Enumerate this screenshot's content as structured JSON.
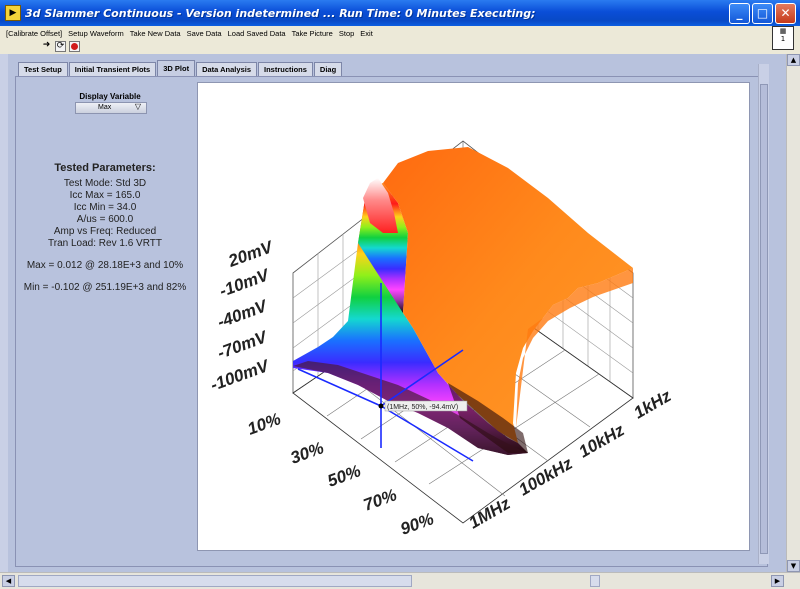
{
  "window": {
    "title": "3d Slammer Continuous - Version indetermined ...  Run Time: 0 Minutes  Executing;"
  },
  "menu": [
    "[Calibrate Offset]",
    "Setup Waveform",
    "Take New Data",
    "Save Data",
    "Load Saved Data",
    "Take Picture",
    "Stop",
    "Exit"
  ],
  "tabs": [
    "Test Setup",
    "Initial Transient Plots",
    "3D Plot",
    "Data Analysis",
    "Instructions",
    "Diag"
  ],
  "active_tab": "3D Plot",
  "display_variable": {
    "label": "Display Variable",
    "value": "Max"
  },
  "params": {
    "heading": "Tested Parameters:",
    "lines": [
      "Test Mode: Std 3D",
      "Icc Max = 165.0",
      "Icc Min = 34.0",
      "A/us = 600.0",
      "Amp vs Freq: Reduced",
      "Tran Load: Rev 1.6 VRTT"
    ],
    "max": "Max = 0.012 @ 28.18E+3 and 10%",
    "min": "Min = -0.102 @ 251.19E+3 and 82%"
  },
  "plot": {
    "z_ticks": [
      "20mV",
      "-10mV",
      "-40mV",
      "-70mV",
      "-100mV"
    ],
    "duty_ticks": [
      "10%",
      "30%",
      "50%",
      "70%",
      "90%"
    ],
    "freq_ticks": [
      "1kHz",
      "10kHz",
      "100kHz",
      "1MHz"
    ],
    "cursor_label": "(1MHz, 50%, -94.4mV)"
  },
  "colors": {
    "titlebar": "#0a4ed8",
    "panel": "#b8c2dd",
    "plot_bg": "#ffffff"
  },
  "icons": [
    "run-arrow-icon",
    "run-continuous-icon",
    "abort-icon"
  ]
}
